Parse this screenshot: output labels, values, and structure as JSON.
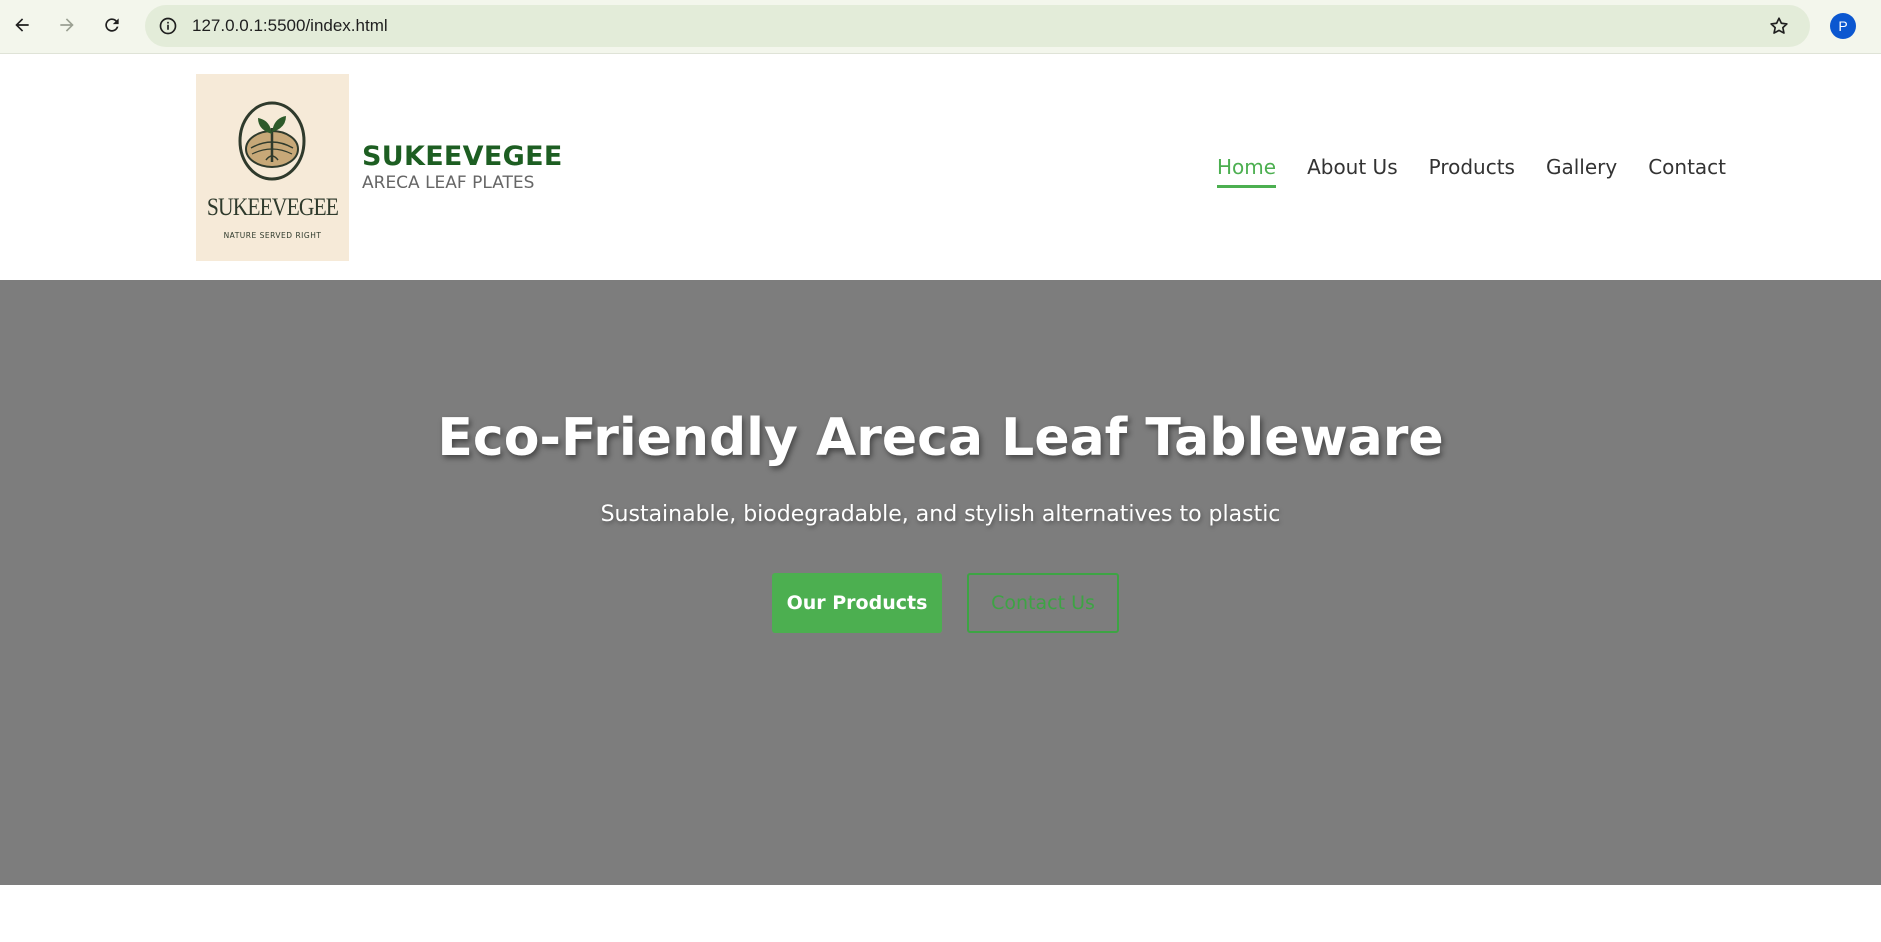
{
  "browser": {
    "url": "127.0.0.1:5500/index.html",
    "profile_initial": "P",
    "icons": [
      "back-arrow-icon",
      "forward-arrow-icon",
      "reload-icon",
      "site-info-icon",
      "bookmark-star-icon"
    ]
  },
  "logo": {
    "wordmark": "SUKEEVEGEE",
    "tagline": "NATURE SERVED RIGHT"
  },
  "brand": {
    "name": "SUKEEVEGEE",
    "subtitle": "ARECA LEAF PLATES"
  },
  "nav": {
    "items": [
      {
        "label": "Home",
        "active": true
      },
      {
        "label": "About Us",
        "active": false
      },
      {
        "label": "Products",
        "active": false
      },
      {
        "label": "Gallery",
        "active": false
      },
      {
        "label": "Contact",
        "active": false
      }
    ]
  },
  "hero": {
    "title": "Eco-Friendly Areca Leaf Tableware",
    "subtitle": "Sustainable, biodegradable, and stylish alternatives to plastic",
    "primary_button": "Our Products",
    "secondary_button": "Contact Us"
  },
  "colors": {
    "accent_green": "#4caf50",
    "brand_green": "#1d5e22",
    "hero_background": "#7d7d7d"
  }
}
